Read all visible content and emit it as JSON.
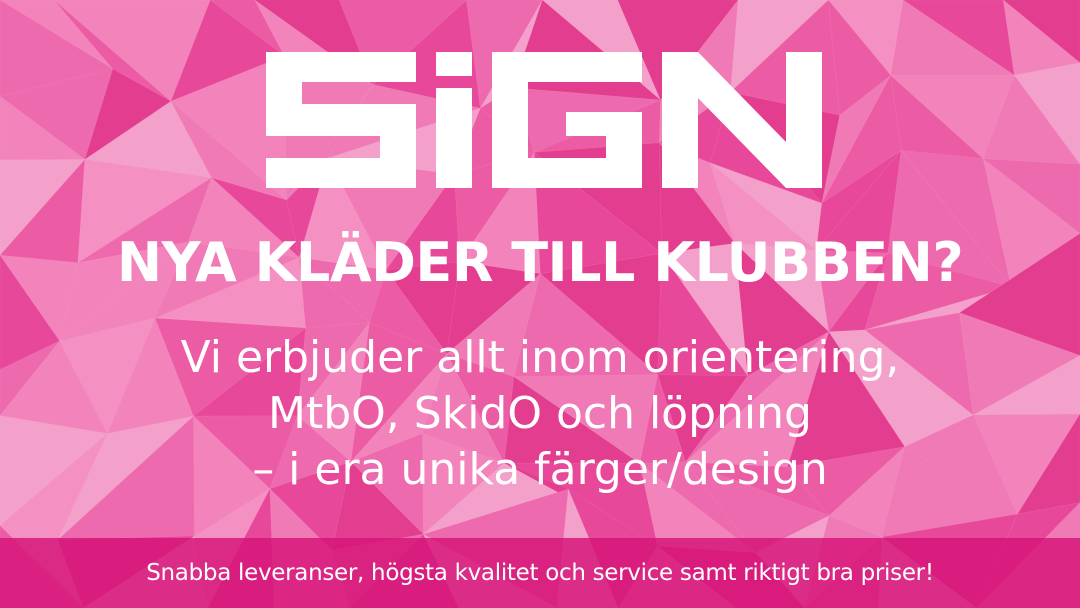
{
  "logo": {
    "text": "SiGN",
    "color": "#ffffff"
  },
  "headline": "NYA KLÄDER TILL KLUBBEN?",
  "body": {
    "lines": [
      "Vi erbjuder allt inom orientering,",
      "MtbO, SkidO och löpning",
      "– i era unika färger/design"
    ]
  },
  "footer": {
    "text": "Snabba leveranser, högsta kvalitet och service samt riktigt bra priser!"
  },
  "colors": {
    "background": "#ef5ea6",
    "background_light": "#f590c3",
    "background_dark": "#e23b8e",
    "footer_band": "#d61478",
    "text": "#ffffff"
  }
}
